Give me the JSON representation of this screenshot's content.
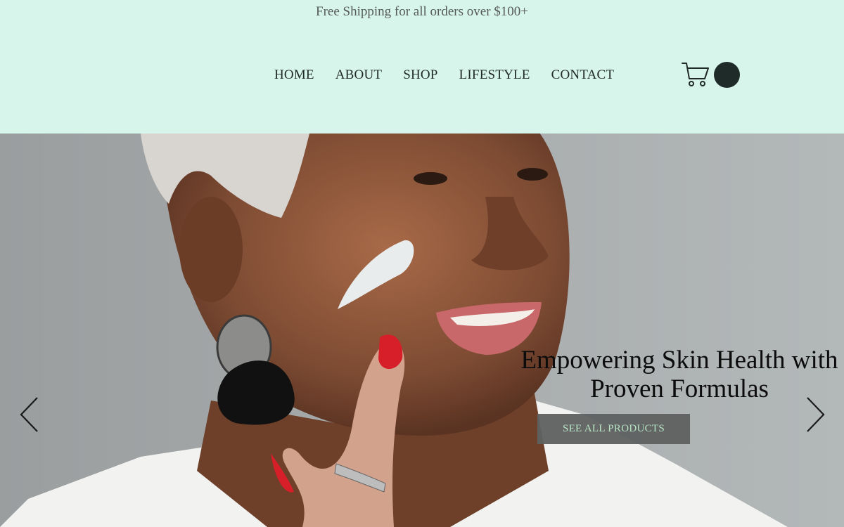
{
  "announcement": {
    "text": "Free Shipping for all orders over $100+"
  },
  "nav": {
    "items": [
      {
        "label": "HOME"
      },
      {
        "label": "ABOUT"
      },
      {
        "label": "SHOP"
      },
      {
        "label": "LIFESTYLE"
      },
      {
        "label": "CONTACT"
      }
    ]
  },
  "cart": {
    "icon": "cart-icon",
    "badge_color": "#1f2b28"
  },
  "hero": {
    "headline_line1": "Empowering Skin Health with",
    "headline_line2": "Proven Formulas",
    "cta_label": "SEE ALL PRODUCTS",
    "prev_icon": "chevron-left-icon",
    "next_icon": "chevron-right-icon"
  },
  "colors": {
    "header_bg": "#d8f5ec",
    "text_dark": "#1f2a26",
    "cta_bg": "#5f6161",
    "cta_text": "#b8e6c4"
  }
}
